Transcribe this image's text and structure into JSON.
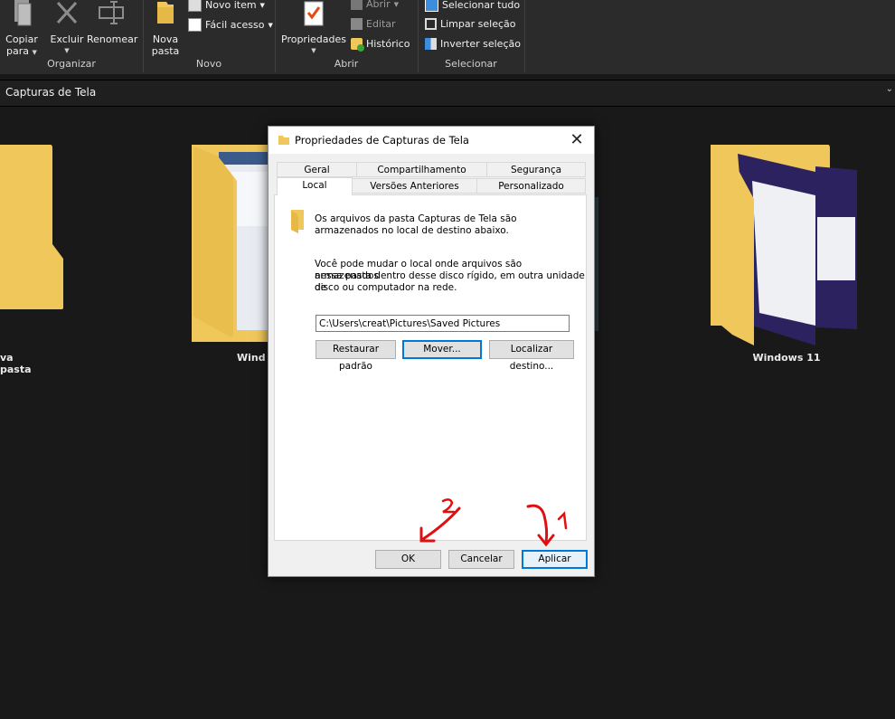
{
  "ribbon": {
    "organizar": {
      "copiar_line1": "Copiar",
      "copiar_line2": "para",
      "excluir": "Excluir",
      "renomear": "Renomear",
      "group_label": "Organizar"
    },
    "novo": {
      "nova_line1": "Nova",
      "nova_line2": "pasta",
      "novo_item": "Novo item",
      "facil_acesso": "Fácil acesso",
      "group_label": "Novo"
    },
    "abrir": {
      "propriedades": "Propriedades",
      "abrir": "Abrir",
      "editar": "Editar",
      "historico": "Histórico",
      "group_label": "Abrir"
    },
    "selecionar": {
      "selecionar_tudo": "Selecionar tudo",
      "limpar_selecao": "Limpar seleção",
      "inverter_selecao": "Inverter seleção",
      "group_label": "Selecionar"
    }
  },
  "address": {
    "path": "Capturas de Tela"
  },
  "folders": [
    {
      "label": "va pasta"
    },
    {
      "label": "Wind"
    },
    {
      "label": "Windows 11"
    }
  ],
  "dialog": {
    "title": "Propriedades de Capturas de Tela",
    "tabs_row1": [
      "Geral",
      "Compartilhamento",
      "Segurança"
    ],
    "tabs_row2": [
      "Local",
      "Versões Anteriores",
      "Personalizado"
    ],
    "info_line1": "Os arquivos da pasta Capturas de Tela são",
    "info_line2": "armazenados no local de destino abaixo.",
    "desc_line1": "Você pode mudar o local onde arquivos são armazenados",
    "desc_line2": "nessa pasta dentro desse disco rígido, em outra unidade de",
    "desc_line3": "disco ou computador na rede.",
    "path_value": "C:\\Users\\creat\\Pictures\\Saved Pictures",
    "btn_restaurar": "Restaurar padrão",
    "btn_mover": "Mover...",
    "btn_localizar": "Localizar destino...",
    "btn_ok": "OK",
    "btn_cancelar": "Cancelar",
    "btn_aplicar": "Aplicar"
  },
  "annotations": {
    "mark1": "1",
    "mark2": "2",
    "color": "#e01010"
  },
  "colors": {
    "folder_yellow": "#f0c75a",
    "folder_dark": "#dcaa35",
    "accent": "#0078d7"
  }
}
